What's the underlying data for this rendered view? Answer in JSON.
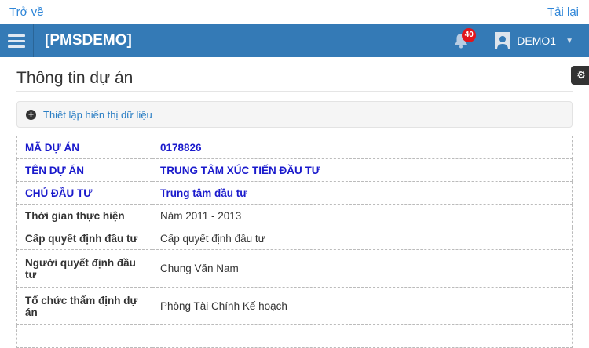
{
  "topbar": {
    "back": "Trở về",
    "reload": "Tải lại"
  },
  "nav": {
    "brand": "[PMSDEMO]",
    "notifications": "40",
    "user": "DEMO1"
  },
  "page": {
    "title": "Thông tin dự án",
    "settings_label": "Thiết lập hiển thị dữ liệu"
  },
  "rows": [
    {
      "label": "MÃ DỰ ÁN",
      "value": "0178826"
    },
    {
      "label": "TÊN DỰ ÁN",
      "value": "TRUNG TÂM XÚC TIẾN ĐẦU TƯ"
    },
    {
      "label": "CHỦ ĐẦU TƯ",
      "value": "Trung tâm đầu tư"
    },
    {
      "label": "Thời gian thực hiện",
      "value": "Năm 2011 - 2013"
    },
    {
      "label": "Cấp quyết định đầu tư",
      "value": "Cấp quyết định đầu tư"
    },
    {
      "label": "Người quyết định đầu tư",
      "value": "Chung Văn Nam"
    },
    {
      "label": "Tổ chức thẩm định dự án",
      "value": "Phòng Tài Chính Kế hoạch"
    }
  ]
}
